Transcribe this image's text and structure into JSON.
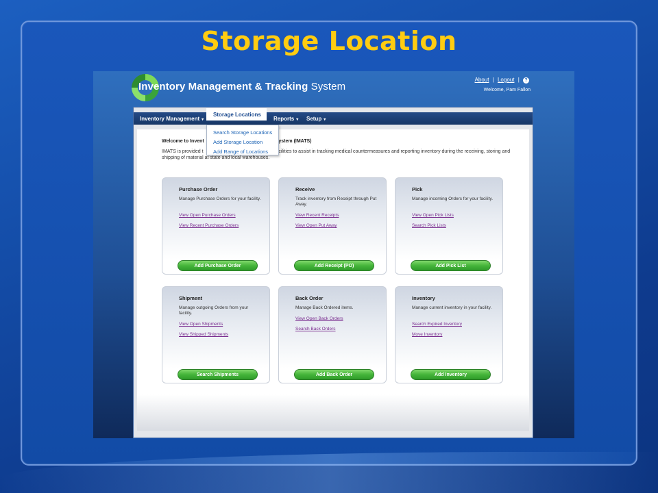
{
  "slide": {
    "title": "Storage Location"
  },
  "app": {
    "title_bold": "Inventory Management & Tracking",
    "title_light": " System",
    "links": {
      "about": "About",
      "logout": "Logout",
      "sep": "|",
      "help_glyph": "?"
    },
    "welcome_user": "Welcome, Pam Fallon"
  },
  "nav": {
    "inventory_management": "Inventory Management",
    "storage_locations": "Storage Locations",
    "reports": "Reports",
    "setup": "Setup",
    "caret": "▾"
  },
  "dropdown": {
    "items": [
      "Search Storage Locations",
      "Add Storage Location",
      "Add Range of Locations"
    ]
  },
  "content": {
    "welcome_visible": "Welcome to Invent",
    "welcome_tail": "System (IMATS)",
    "intro_head": "IMATS is provided t",
    "intro_tail": "facilities to assist in tracking medical countermeasures and reporting inventory during the receiving, storing and shipping of material at state and local warehouses."
  },
  "cards": [
    {
      "title": "Purchase Order",
      "desc": "Manage Purchase Orders for your facility.",
      "links": [
        "View Open Purchase Orders",
        "View Recent Purchase Orders"
      ],
      "button": "Add Purchase Order"
    },
    {
      "title": "Receive",
      "desc": "Track inventory from Receipt through Put Away.",
      "links": [
        "View Recent Receipts",
        "View Open Put Away"
      ],
      "button": "Add Receipt (PO)"
    },
    {
      "title": "Pick",
      "desc": "Manage incoming Orders for your facility.",
      "links": [
        "View Open Pick Lists",
        "Search Pick Lists"
      ],
      "button": "Add Pick List"
    },
    {
      "title": "Shipment",
      "desc": "Manage outgoing Orders from your facility.",
      "links": [
        "View Open Shipments",
        "View Shipped Shipments"
      ],
      "button": "Search Shipments"
    },
    {
      "title": "Back Order",
      "desc": "Manage Back Ordered items.",
      "links": [
        "View Open Back Orders",
        "Search Back Orders"
      ],
      "button": "Add Back Order"
    },
    {
      "title": "Inventory",
      "desc": "Manage current inventory in your facility.",
      "links": [
        "Search Expired Inventory",
        "Move Inventory"
      ],
      "button": "Add Inventory"
    }
  ]
}
